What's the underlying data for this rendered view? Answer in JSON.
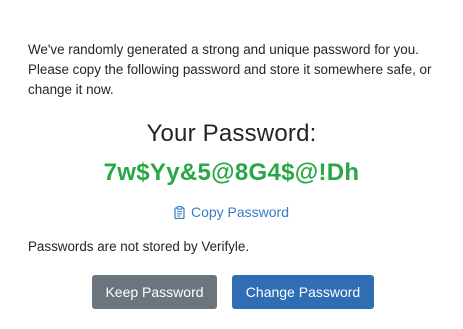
{
  "intro": {
    "text": "We've randomly generated a strong and unique password for you. Please copy the following password and store it somewhere safe, or change it now."
  },
  "heading": "Your Password:",
  "password": "7w$Yy&5@8G4$@!Dh",
  "copy": {
    "label": "Copy Password",
    "icon": "clipboard-icon"
  },
  "note": "Passwords are not stored by Verifyle.",
  "buttons": {
    "keep_label": "Keep Password",
    "change_label": "Change Password"
  },
  "colors": {
    "password": "#28a745",
    "link": "#3a7bc8",
    "keep_button": "#6c757d",
    "change_button": "#2f6db5"
  }
}
